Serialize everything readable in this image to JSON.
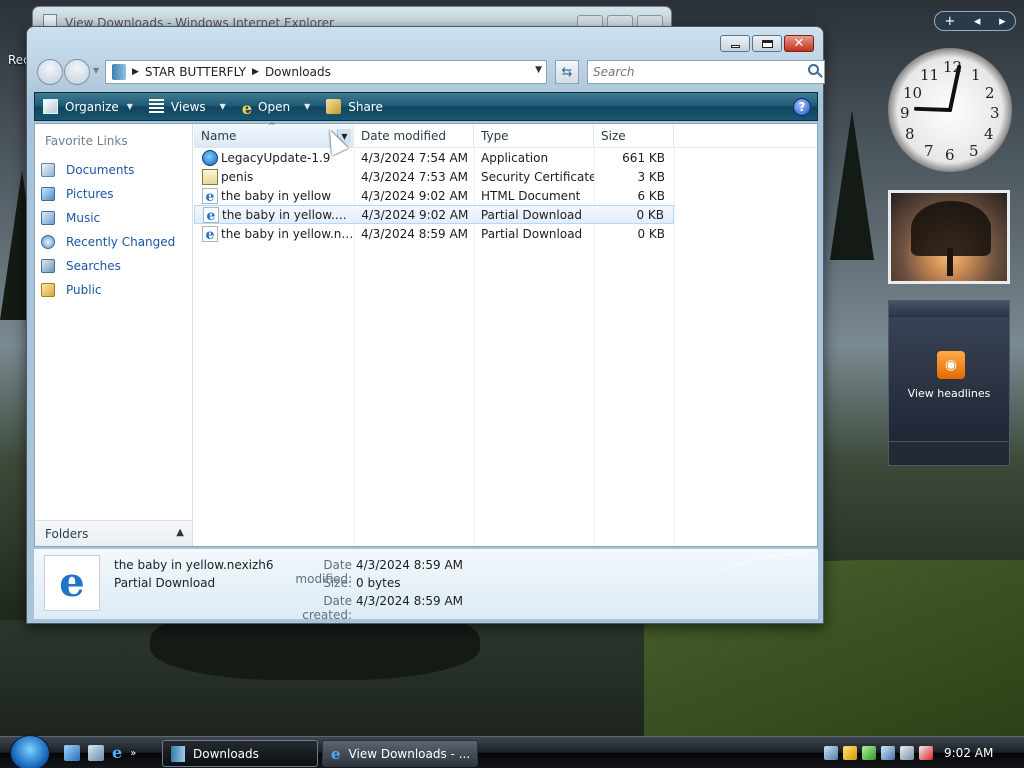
{
  "desktop": {
    "recycle_label": "Rec"
  },
  "background_window": {
    "title": "View Downloads - Windows Internet Explorer"
  },
  "window": {
    "breadcrumbs": [
      "STAR BUTTERFLY",
      "Downloads"
    ],
    "search_placeholder": "Search"
  },
  "toolbar": {
    "organize_label": "Organize",
    "views_label": "Views",
    "open_label": "Open",
    "share_label": "Share",
    "help_label": "?"
  },
  "nav_pane": {
    "title": "Favorite Links",
    "items": [
      {
        "label": "Documents",
        "icon": "documents-icon"
      },
      {
        "label": "Pictures",
        "icon": "pictures-icon"
      },
      {
        "label": "Music",
        "icon": "music-icon"
      },
      {
        "label": "Recently Changed",
        "icon": "recently-changed-icon"
      },
      {
        "label": "Searches",
        "icon": "searches-icon"
      },
      {
        "label": "Public",
        "icon": "public-folder-icon"
      }
    ],
    "folders_label": "Folders"
  },
  "file_list": {
    "columns": [
      "Name",
      "Date modified",
      "Type",
      "Size"
    ],
    "rows": [
      {
        "name": "LegacyUpdate-1.9",
        "date": "4/3/2024 7:54 AM",
        "type": "Application",
        "size": "661 KB",
        "icon": "application-icon"
      },
      {
        "name": "penis",
        "date": "4/3/2024 7:53 AM",
        "type": "Security Certificate",
        "size": "3 KB",
        "icon": "certificate-icon"
      },
      {
        "name": "the baby in yellow",
        "date": "4/3/2024 9:02 AM",
        "type": "HTML Document",
        "size": "6 KB",
        "icon": "ie-document-icon"
      },
      {
        "name": "the baby in yellow.nexi...",
        "date": "4/3/2024 9:02 AM",
        "type": "Partial Download",
        "size": "0 KB",
        "icon": "ie-document-icon",
        "selected": true
      },
      {
        "name": "the baby in yellow.nexi...",
        "date": "4/3/2024 8:59 AM",
        "type": "Partial Download",
        "size": "0 KB",
        "icon": "ie-document-icon"
      }
    ]
  },
  "details": {
    "file_name": "the baby in yellow.nexizh6",
    "file_type": "Partial Download",
    "props": [
      {
        "label": "Date modified:",
        "value": "4/3/2024 8:59 AM"
      },
      {
        "label": "Size:",
        "value": "0 bytes"
      },
      {
        "label": "Date created:",
        "value": "4/3/2024 8:59 AM"
      }
    ]
  },
  "gadgets": {
    "feed_label": "View headlines",
    "clock_numbers": [
      "12",
      "1",
      "2",
      "3",
      "4",
      "5",
      "6",
      "7",
      "8",
      "9",
      "10",
      "11"
    ]
  },
  "taskbar": {
    "buttons": [
      {
        "label": "Downloads"
      },
      {
        "label": "View Downloads - ..."
      }
    ],
    "time": "9:02 AM"
  }
}
